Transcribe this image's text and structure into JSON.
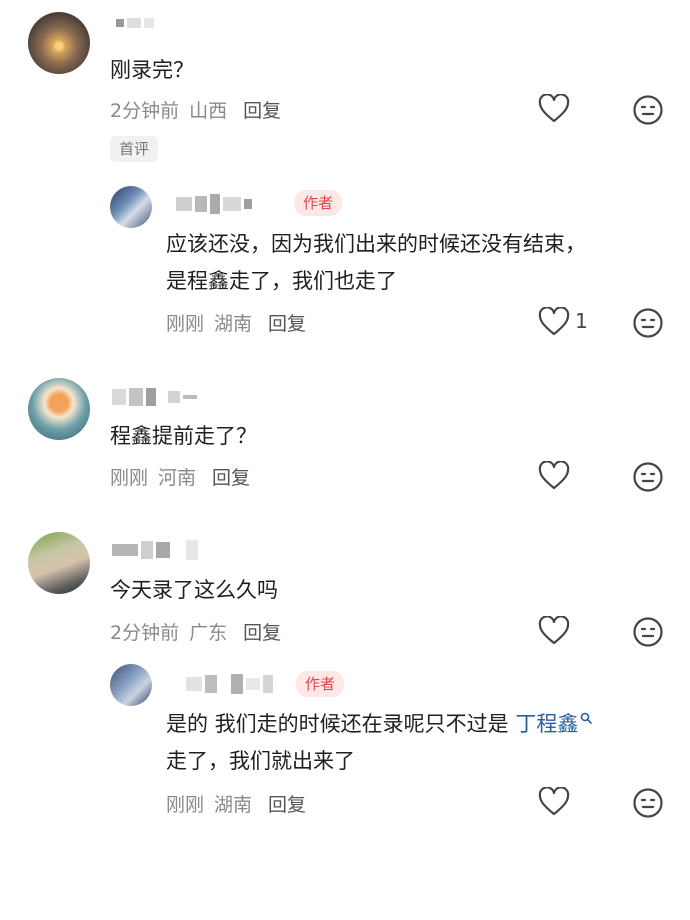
{
  "comments": [
    {
      "text": "刚录完？",
      "time": "2分钟前",
      "location": "山西",
      "reply_label": "回复",
      "badge": "首评",
      "reply": {
        "author_tag": "作者",
        "text_line1": "应该还没，因为我们出来的时候还没有结束，",
        "text_line2": "是程鑫走了，我们也走了",
        "time": "刚刚",
        "location": "湖南",
        "reply_label": "回复",
        "like_count": "1"
      }
    },
    {
      "text": "程鑫提前走了？",
      "time": "刚刚",
      "location": "河南",
      "reply_label": "回复"
    },
    {
      "text": "今天录了这么久吗",
      "time": "2分钟前",
      "location": "广东",
      "reply_label": "回复",
      "reply": {
        "author_tag": "作者",
        "text_prefix": "是的 我们走的时候还在录呢只不过是 ",
        "mention": "丁程鑫",
        "text_line2": "走了，我们就出来了",
        "time": "刚刚",
        "location": "湖南",
        "reply_label": "回复"
      }
    }
  ],
  "icons": {
    "like": "heart-outline-icon",
    "dislike": "neutral-face-icon",
    "mention": "search-icon"
  },
  "colors": {
    "author_tag_bg": "#fde7e7",
    "author_tag_text": "#e0484d",
    "mention": "#2a5f9e"
  }
}
